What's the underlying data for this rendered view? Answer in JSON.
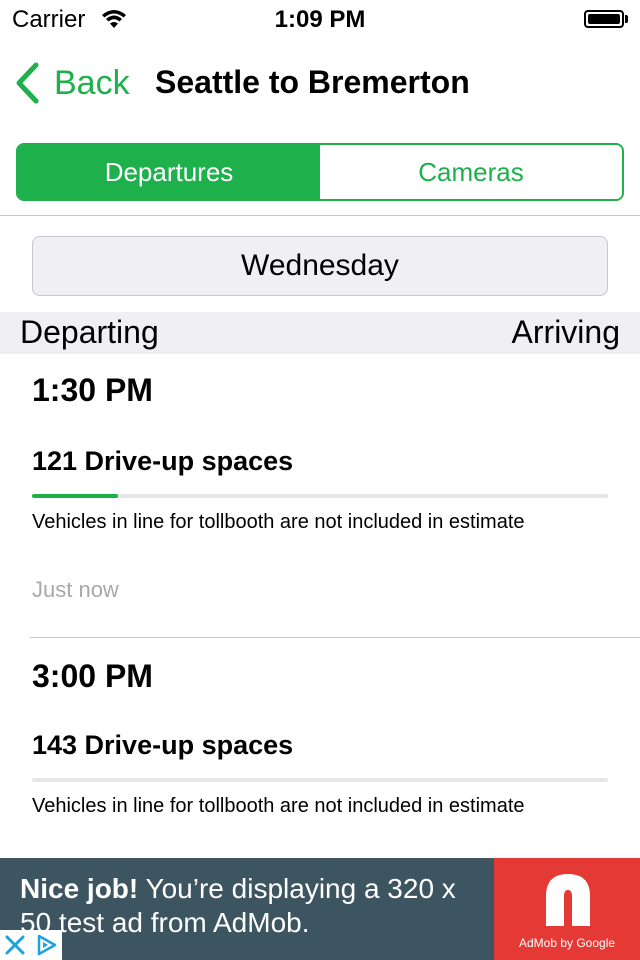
{
  "status_bar": {
    "carrier": "Carrier",
    "time": "1:09 PM"
  },
  "nav": {
    "back_label": "Back",
    "title": "Seattle to Bremerton"
  },
  "tabs": [
    {
      "label": "Departures",
      "active": true
    },
    {
      "label": "Cameras",
      "active": false
    }
  ],
  "day_picker": {
    "value": "Wednesday"
  },
  "table_header": {
    "left": "Departing",
    "right": "Arriving"
  },
  "sailings": [
    {
      "time": "1:30 PM",
      "spaces": "121 Drive-up spaces",
      "fill_fraction": 0.15,
      "note": "Vehicles in line for tollbooth are not included in estimate",
      "updated": "Just now"
    },
    {
      "time": "3:00 PM",
      "spaces": "143 Drive-up spaces",
      "fill_fraction": 0.0,
      "note": "Vehicles in line for tollbooth are not included in estimate"
    }
  ],
  "ad": {
    "headline": "Nice job!",
    "body": " You’re displaying a 320 x 50 test ad from AdMob.",
    "logo_caption": "AdMob by Google"
  },
  "colors": {
    "accent": "#1db04b",
    "ad_bg": "#3d5461",
    "ad_logo_bg": "#e53935",
    "section_bg": "#efeff4"
  }
}
